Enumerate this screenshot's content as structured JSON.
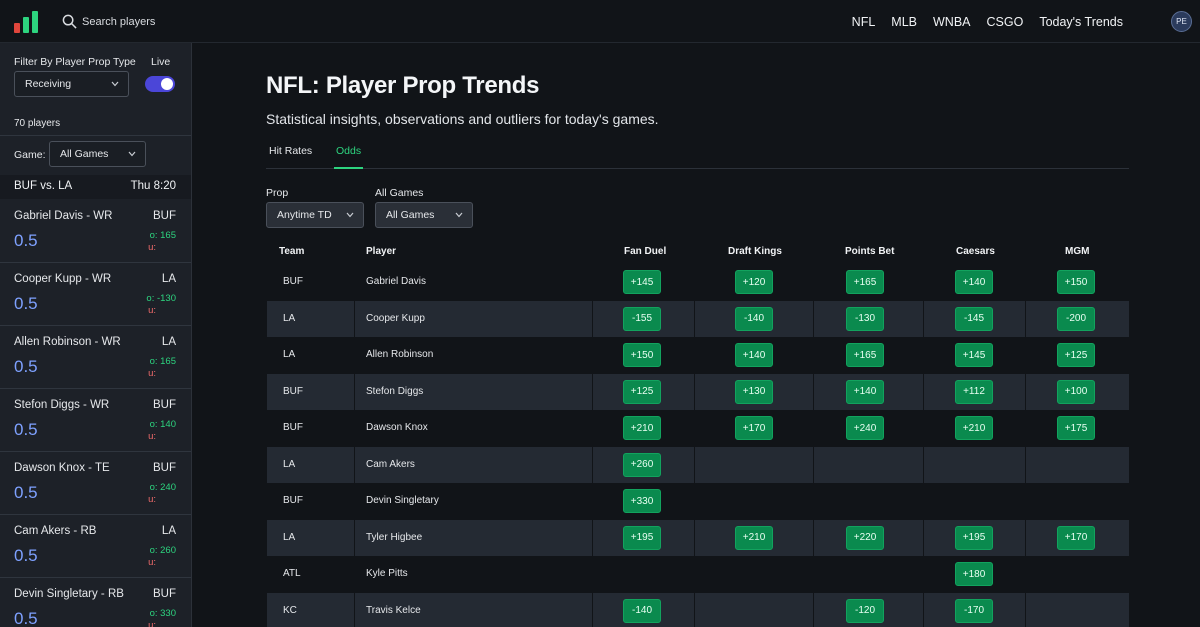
{
  "nav": {
    "search_placeholder": "Search players",
    "links": [
      "NFL",
      "MLB",
      "WNBA",
      "CSGO",
      "Today's Trends"
    ],
    "avatar_initials": "PE"
  },
  "colors": {
    "accent": "#2dd47f",
    "odds_button": "#0a8a4e",
    "line": "#7ea1ff",
    "under": "#f06b6b",
    "toggle": "#4b46d8"
  },
  "sidebar": {
    "filter_label": "Filter By Player Prop Type",
    "live_label": "Live",
    "live_on": true,
    "prop_type": "Receiving",
    "players_count": "70 players",
    "game_label": "Game:",
    "game_value": "All Games",
    "matchup": {
      "teams": "BUF vs. LA",
      "time": "Thu 8:20"
    },
    "players": [
      {
        "name": "Gabriel Davis - WR",
        "team": "BUF",
        "line": "0.5",
        "over": "o: 165",
        "under": "u:"
      },
      {
        "name": "Cooper Kupp - WR",
        "team": "LA",
        "line": "0.5",
        "over": "o: -130",
        "under": "u:"
      },
      {
        "name": "Allen Robinson - WR",
        "team": "LA",
        "line": "0.5",
        "over": "o: 165",
        "under": "u:"
      },
      {
        "name": "Stefon Diggs - WR",
        "team": "BUF",
        "line": "0.5",
        "over": "o: 140",
        "under": "u:"
      },
      {
        "name": "Dawson Knox - TE",
        "team": "BUF",
        "line": "0.5",
        "over": "o: 240",
        "under": "u:"
      },
      {
        "name": "Cam Akers - RB",
        "team": "LA",
        "line": "0.5",
        "over": "o: 260",
        "under": "u:"
      },
      {
        "name": "Devin Singletary - RB",
        "team": "BUF",
        "line": "0.5",
        "over": "o: 330",
        "under": "u:"
      }
    ]
  },
  "main": {
    "title": "NFL: Player Prop Trends",
    "subtitle": "Statistical insights, observations and outliers for today's games.",
    "tabs": [
      {
        "label": "Hit Rates",
        "active": false
      },
      {
        "label": "Odds",
        "active": true
      }
    ],
    "prop_label": "Prop",
    "prop_value": "Anytime TD",
    "games_label": "All Games",
    "games_value": "All Games",
    "table": {
      "headers": [
        "Team",
        "Player",
        "Fan Duel",
        "Draft Kings",
        "Points Bet",
        "Caesars",
        "MGM"
      ],
      "rows": [
        {
          "team": "BUF",
          "player": "Gabriel Davis",
          "odds": [
            "+145",
            "+120",
            "+165",
            "+140",
            "+150"
          ]
        },
        {
          "team": "LA",
          "player": "Cooper Kupp",
          "odds": [
            "-155",
            "-140",
            "-130",
            "-145",
            "-200"
          ]
        },
        {
          "team": "LA",
          "player": "Allen Robinson",
          "odds": [
            "+150",
            "+140",
            "+165",
            "+145",
            "+125"
          ]
        },
        {
          "team": "BUF",
          "player": "Stefon Diggs",
          "odds": [
            "+125",
            "+130",
            "+140",
            "+112",
            "+100"
          ]
        },
        {
          "team": "BUF",
          "player": "Dawson Knox",
          "odds": [
            "+210",
            "+170",
            "+240",
            "+210",
            "+175"
          ]
        },
        {
          "team": "LA",
          "player": "Cam Akers",
          "odds": [
            "+260",
            "",
            "",
            "",
            ""
          ]
        },
        {
          "team": "BUF",
          "player": "Devin Singletary",
          "odds": [
            "+330",
            "",
            "",
            "",
            ""
          ]
        },
        {
          "team": "LA",
          "player": "Tyler Higbee",
          "odds": [
            "+195",
            "+210",
            "+220",
            "+195",
            "+170"
          ]
        },
        {
          "team": "ATL",
          "player": "Kyle Pitts",
          "odds": [
            "",
            "",
            "",
            "+180",
            ""
          ]
        },
        {
          "team": "KC",
          "player": "Travis Kelce",
          "odds": [
            "-140",
            "",
            "-120",
            "-170",
            ""
          ]
        }
      ]
    }
  }
}
